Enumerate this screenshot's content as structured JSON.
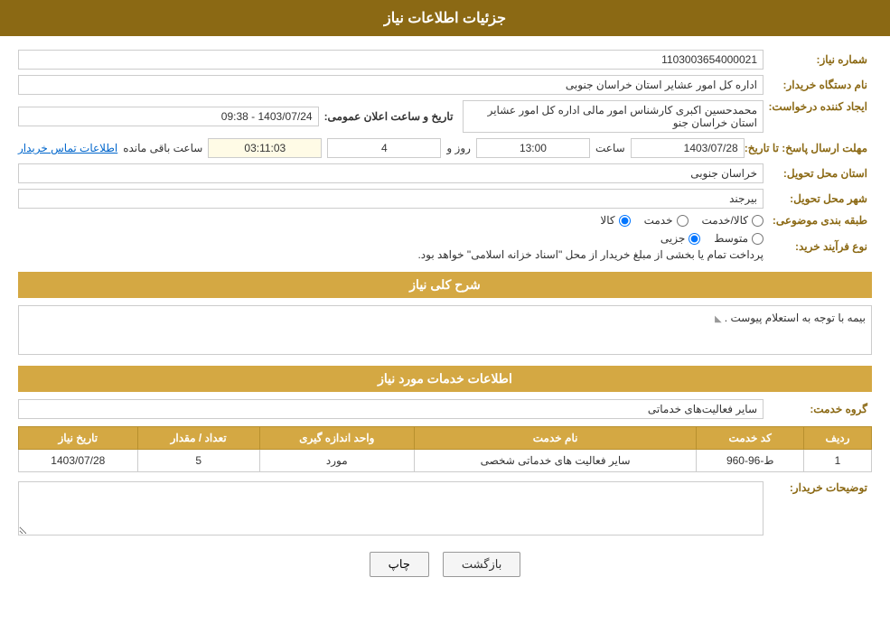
{
  "header": {
    "title": "جزئیات اطلاعات نیاز"
  },
  "fields": {
    "niyaz_number_label": "شماره نیاز:",
    "niyaz_number_value": "1103003654000021",
    "buyer_name_label": "نام دستگاه خریدار:",
    "buyer_name_value": "اداره کل امور عشایر استان خراسان جنوبی",
    "announcement_label": "تاریخ و ساعت اعلان عمومی:",
    "announcement_value": "1403/07/24 - 09:38",
    "creator_label": "ایجاد کننده درخواست:",
    "creator_value": "محمدحسین اکبری کارشناس امور مالی اداره کل امور عشایر استان خراسان جنو",
    "contact_info_label": "اطلاعات تماس خریدار",
    "response_deadline_label": "مهلت ارسال پاسخ: تا تاریخ:",
    "response_date": "1403/07/28",
    "response_time_label": "ساعت",
    "response_time": "13:00",
    "response_days_label": "روز و",
    "response_days": "4",
    "response_remain_label": "ساعت باقی مانده",
    "response_remain": "03:11:03",
    "delivery_province_label": "استان محل تحویل:",
    "delivery_province_value": "خراسان جنوبی",
    "delivery_city_label": "شهر محل تحویل:",
    "delivery_city_value": "بیرجند",
    "category_label": "طبقه بندی موضوعی:",
    "category_kala": "کالا",
    "category_khedmat": "خدمت",
    "category_kala_khedmat": "کالا/خدمت",
    "process_label": "نوع فرآیند خرید:",
    "process_jozi": "جزیی",
    "process_motavasset": "متوسط",
    "process_description": "پرداخت تمام یا بخشی از مبلغ خریدار از محل \"اسناد خزانه اسلامی\" خواهد بود.",
    "description_label": "شرح کلی نیاز:",
    "description_value": "بیمه با توجه به استعلام پیوست .",
    "services_section_title": "اطلاعات خدمات مورد نیاز",
    "group_service_label": "گروه خدمت:",
    "group_service_value": "سایر فعالیت‌های خدماتی",
    "table_headers": {
      "row_number": "ردیف",
      "service_code": "کد خدمت",
      "service_name": "نام خدمت",
      "unit": "واحد اندازه گیری",
      "quantity": "تعداد / مقدار",
      "date": "تاریخ نیاز"
    },
    "table_rows": [
      {
        "row": "1",
        "code": "ط-96-960",
        "name": "سایر فعالیت های خدماتی شخصی",
        "unit": "مورد",
        "quantity": "5",
        "date": "1403/07/28"
      }
    ],
    "buyer_notes_label": "توضیحات خریدار:",
    "buyer_notes_value": ""
  },
  "buttons": {
    "print_label": "چاپ",
    "back_label": "بازگشت"
  }
}
